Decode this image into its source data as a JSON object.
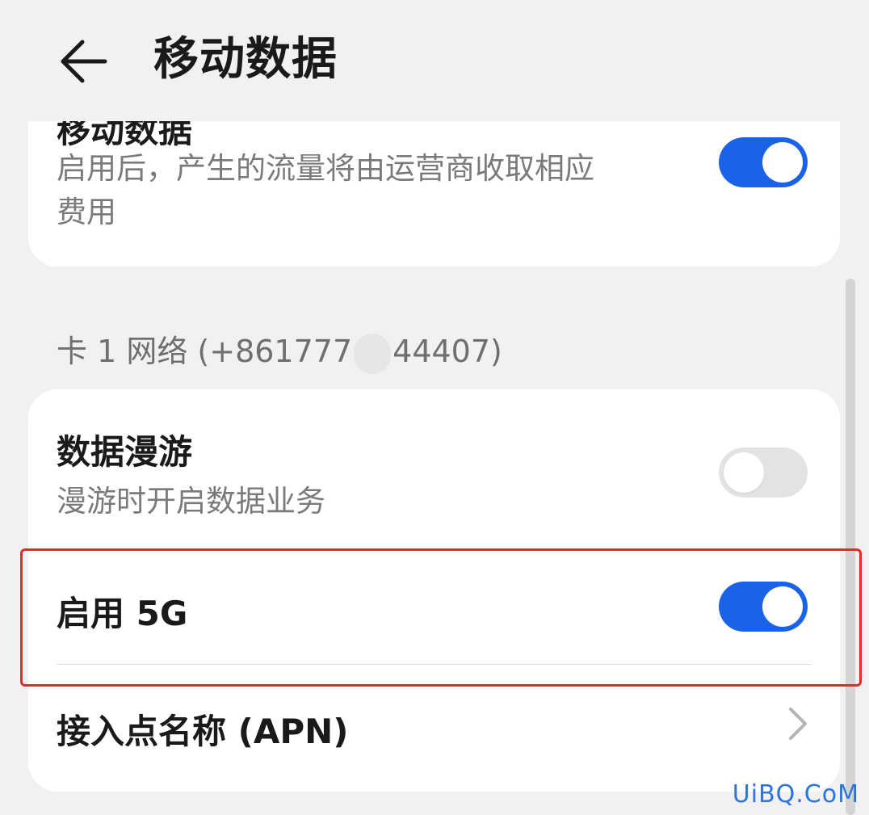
{
  "header": {
    "title": "移动数据",
    "back_icon": "arrow-left-icon"
  },
  "mobile_data_card": {
    "title_partial": "移动数据",
    "subtitle_line1": "启用后，产生的流量将由运营商收取相应",
    "subtitle_line2": "费用",
    "toggle_state": "on"
  },
  "sim_section": {
    "label_prefix": "卡 1 网络 (+861777",
    "label_suffix": "44407)"
  },
  "roaming": {
    "title": "数据漫游",
    "subtitle": "漫游时开启数据业务",
    "toggle_state": "off"
  },
  "enable_5g": {
    "title": "启用 5G",
    "toggle_state": "on"
  },
  "apn": {
    "title": "接入点名称 (APN)",
    "chevron_icon": "chevron-right-icon"
  },
  "colors": {
    "accent": "#1a62e8",
    "highlight": "#e12b2b",
    "background": "#f1f1f1",
    "watermark": "#2b74e0"
  },
  "watermark": "UiBQ.CoM"
}
